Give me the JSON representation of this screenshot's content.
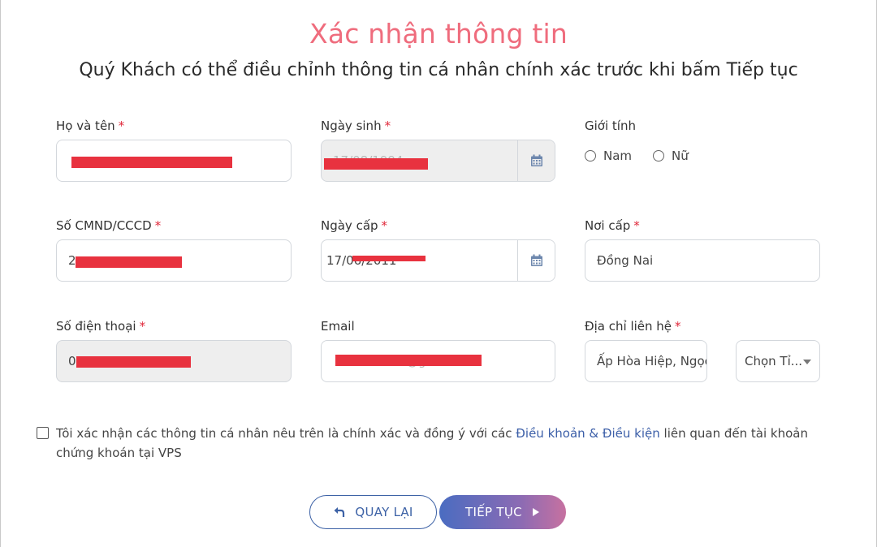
{
  "header": {
    "title": "Xác nhận thông tin",
    "subtitle": "Quý Khách có thể điều chỉnh thông tin cá nhân chính xác trước khi bấm Tiếp tục"
  },
  "form": {
    "full_name": {
      "label": "Họ và tên",
      "required": "*",
      "value": ""
    },
    "dob": {
      "label": "Ngày sinh",
      "required": "*",
      "value": "17/08/1994"
    },
    "gender": {
      "label": "Giới tính",
      "options": [
        "Nam",
        "Nữ"
      ]
    },
    "id_number": {
      "label": "Số CMND/CCCD",
      "required": "*",
      "value": "2"
    },
    "issue_date": {
      "label": "Ngày cấp",
      "required": "*",
      "value": "17/06/2011"
    },
    "issue_place": {
      "label": "Nơi cấp",
      "required": "*",
      "value": "Đồng Nai"
    },
    "phone": {
      "label": "Số điện thoại",
      "required": "*",
      "value": "0"
    },
    "email": {
      "label": "Email",
      "value": "@gmail.com"
    },
    "address": {
      "label": "Địa chỉ liên hệ",
      "required": "*",
      "value": "Ấp Hòa Hiệp, Ngọc",
      "province_select": "Chọn Tỉ..."
    }
  },
  "consent": {
    "text_before": "Tôi xác nhận các thông tin cá nhân nêu trên là chính xác và đồng ý với các ",
    "link": "Điều khoản & Điều kiện",
    "text_after": " liên quan đến tài khoản chứng khoán tại VPS"
  },
  "buttons": {
    "back": "QUAY LẠI",
    "next": "TIẾP TỤC"
  },
  "colors": {
    "title": "#ef6c7d",
    "required": "#e0283a",
    "link": "#3c5fa8",
    "redaction": "#e8323f"
  },
  "icons": {
    "calendar": "calendar-icon",
    "back": "return-arrow-icon",
    "next": "play-arrow-icon",
    "select": "caret-down-icon"
  }
}
